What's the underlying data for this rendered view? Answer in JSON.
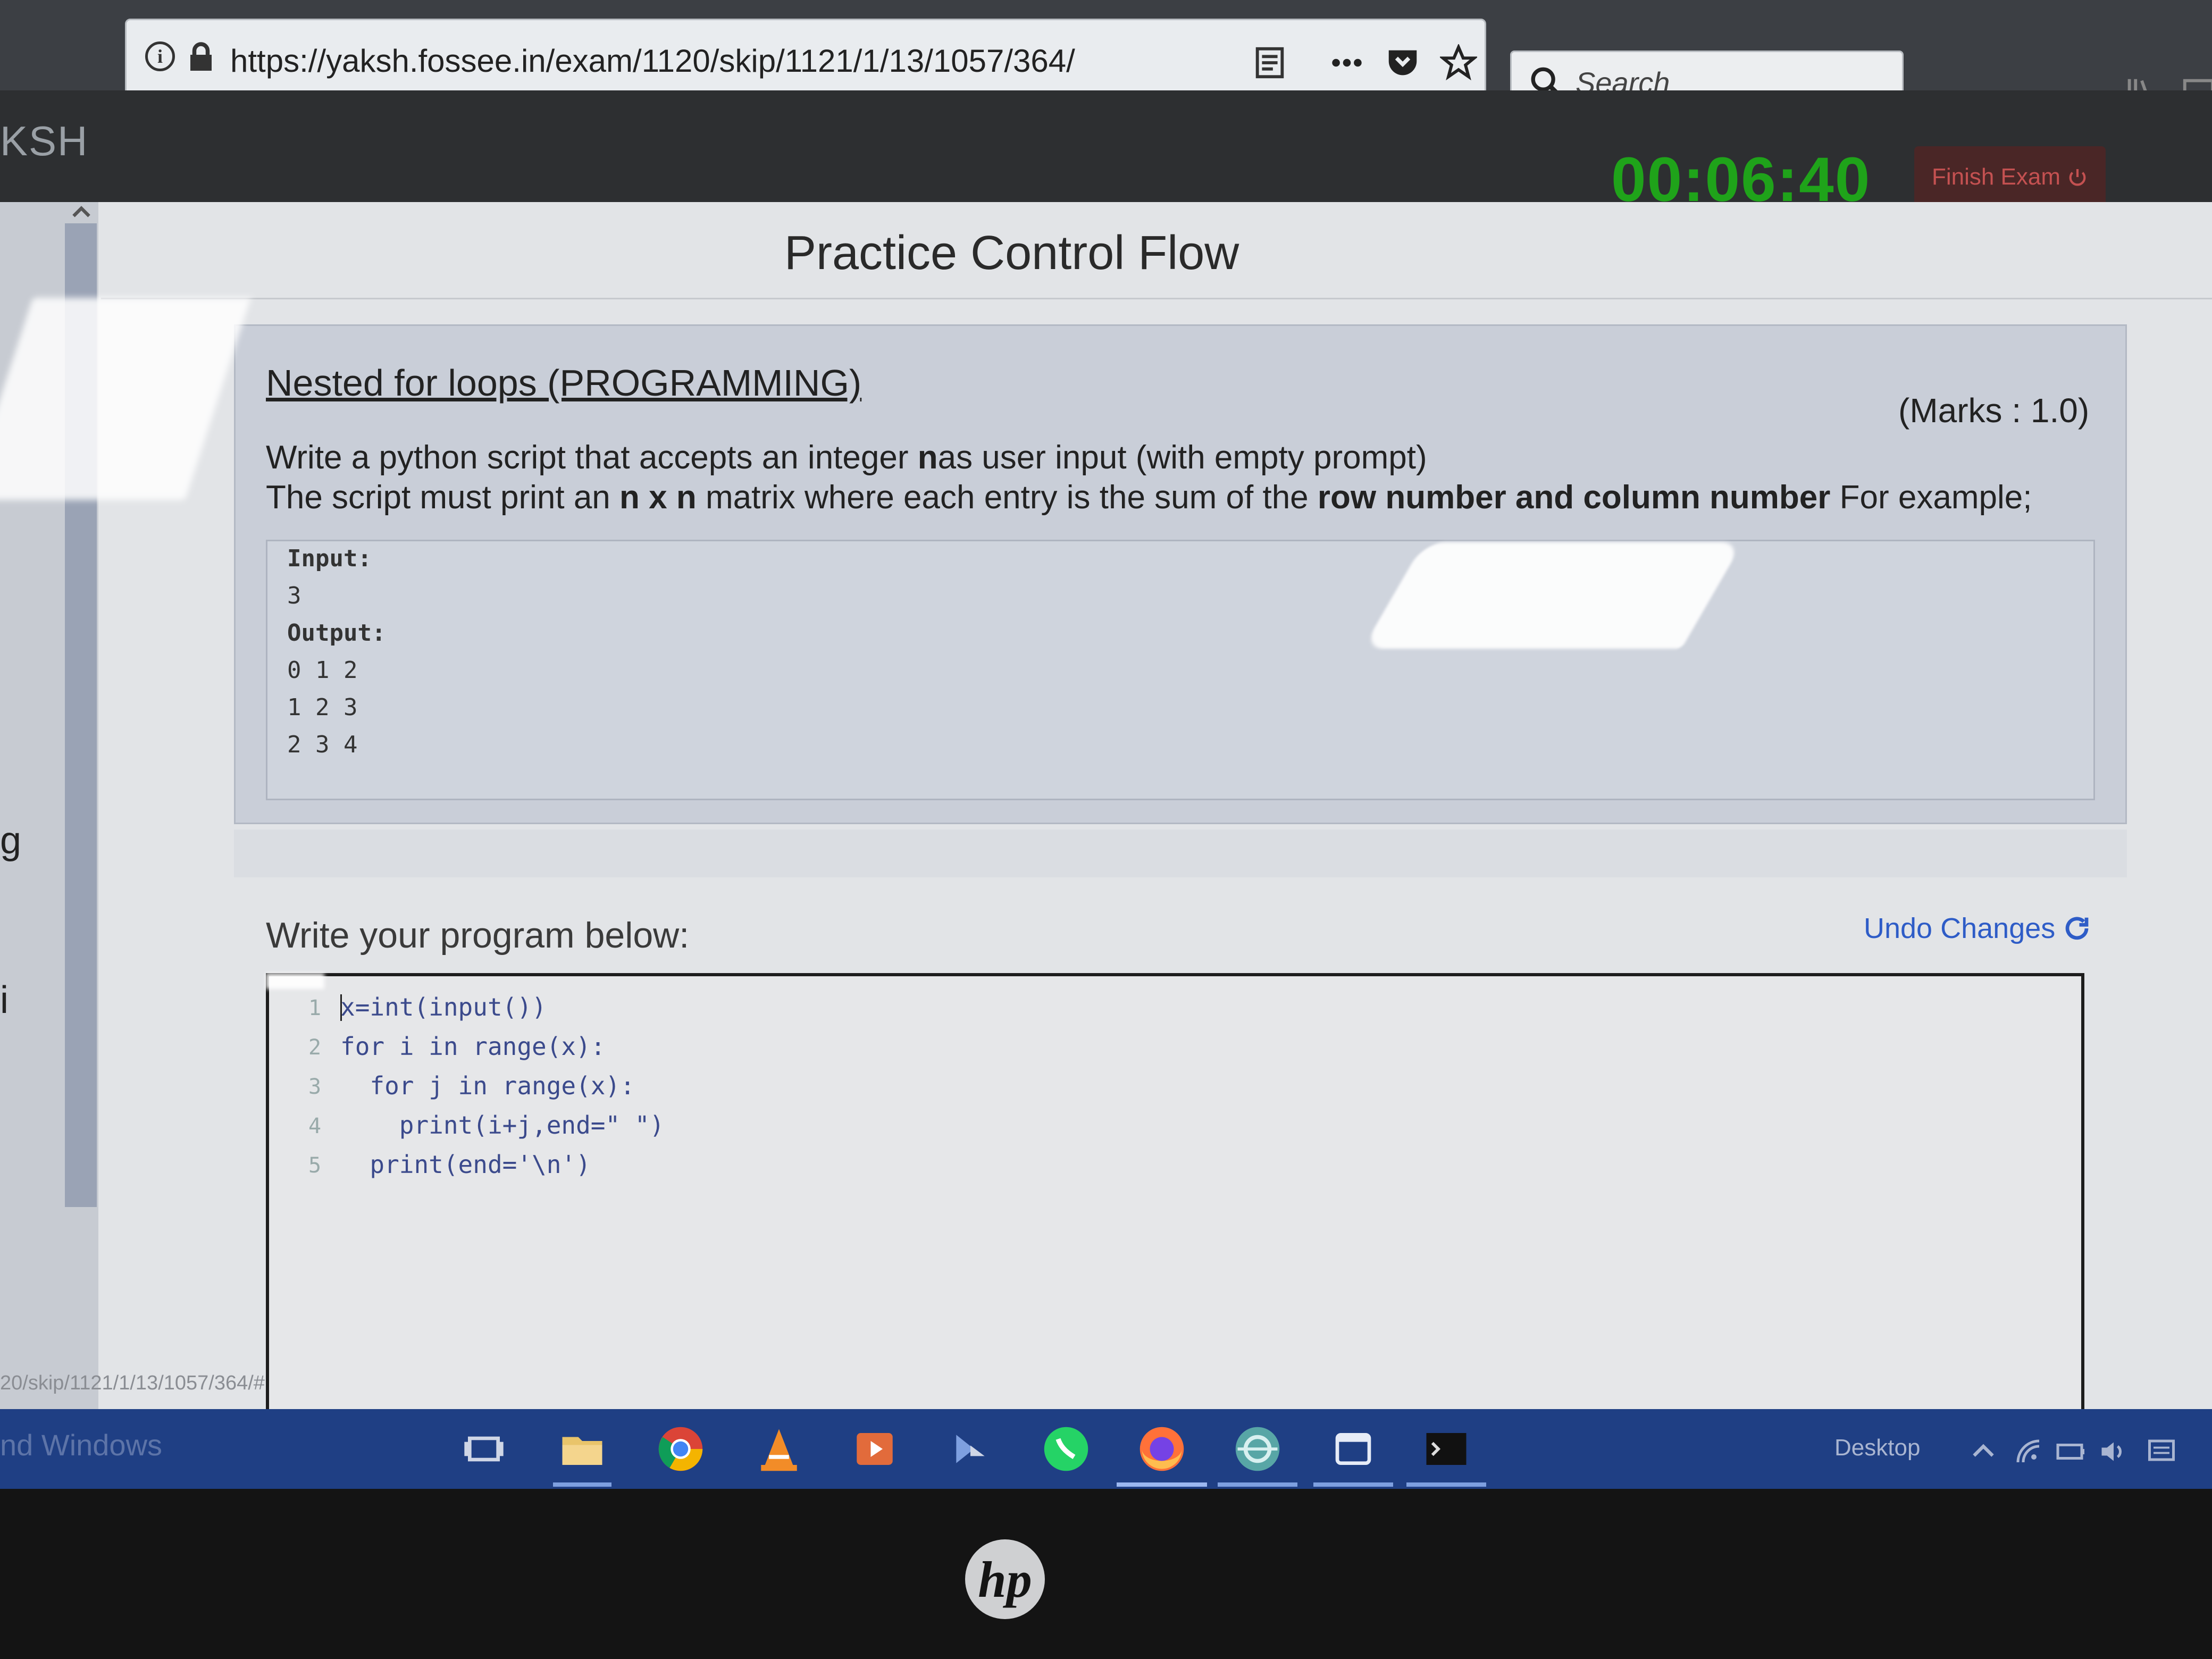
{
  "browser": {
    "url": "https://yaksh.fossee.in/exam/1120/skip/1121/1/13/1057/364/",
    "search_placeholder": "Search"
  },
  "header": {
    "brand": "KSH",
    "timer": "00:06:40",
    "finish_button": "Finish Exam",
    "timer_color": "#1fa31a"
  },
  "page": {
    "title": "Practice Control Flow"
  },
  "question": {
    "title": "Nested for loops (PROGRAMMING)",
    "marks": "(Marks : 1.0)",
    "line1_a": "Write a python script that accepts an integer ",
    "line1_b": "n",
    "line1_c": "as user input (with empty prompt)",
    "line2_a": "The script must print an ",
    "line2_b": "n x n",
    "line2_c": " matrix where each entry is the sum of the ",
    "line2_d": "row number and column number",
    "line2_e": " For example;",
    "example": [
      "Input:",
      "3",
      "Output:",
      "0 1 2",
      "1 2 3",
      "2 3 4"
    ]
  },
  "editor": {
    "label": "Write your program below:",
    "undo_label": "Undo Changes",
    "line_numbers": [
      "1",
      "2",
      "3",
      "4",
      "5"
    ],
    "code": [
      "x=int(input())",
      "for i in range(x):",
      "  for j in range(x):",
      "    print(i+j,end=\" \")",
      "  print(end='\\n')"
    ]
  },
  "side_fragments": {
    "g": "g",
    "i": "i"
  },
  "status_bar_url": "20/skip/1121/1/13/1057/364/#",
  "taskbar": {
    "activate_text": "nd Windows",
    "desktop_label": "Desktop",
    "icons": [
      "task-view-icon",
      "file-explorer-icon",
      "chrome-icon",
      "vlc-icon",
      "media-player-icon",
      "ide-icon",
      "whatsapp-icon",
      "firefox-icon",
      "network-app-icon",
      "window-app-icon",
      "terminal-icon"
    ]
  },
  "device": {
    "logo": "hp"
  }
}
